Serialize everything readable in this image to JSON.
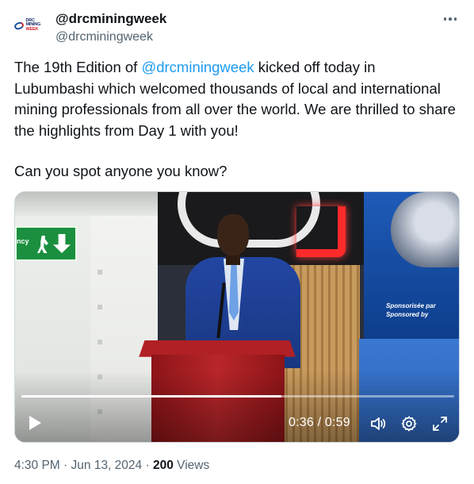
{
  "account": {
    "display_name": "@drcminingweek",
    "handle": "@drcminingweek",
    "avatar_text": [
      "DRC MINING",
      "WEEK"
    ]
  },
  "tweet": {
    "text_before": "The 19th Edition of ",
    "mention": "@drcminingweek",
    "text_after": " kicked off today in Lubumbashi which welcomed thousands of local and international mining professionals from all over the world. We are thrilled to share the highlights from Day 1 with you!",
    "question": "Can you spot anyone you know?"
  },
  "video": {
    "current_time": "0:36",
    "separator": " / ",
    "duration": "0:59",
    "progress_fraction": 0.6,
    "sponsor_lines": [
      "Sponsorisée par",
      "Sponsored by"
    ],
    "exit_sign_text": "ncy"
  },
  "footer": {
    "time": "4:30 PM",
    "date": "Jun 13, 2024",
    "views_count": "200",
    "views_label": "Views",
    "dot": "·"
  },
  "colors": {
    "mention": "#1d9bf0",
    "text": "#0f1419",
    "secondary": "#536471"
  }
}
